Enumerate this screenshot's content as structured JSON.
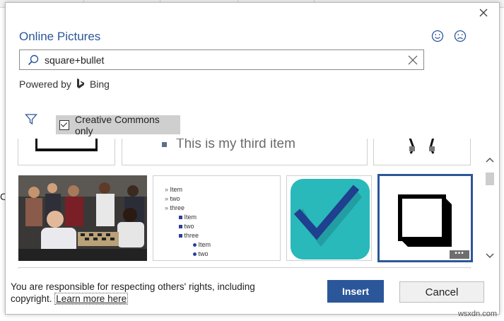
{
  "dialog": {
    "title": "Online Pictures",
    "close_icon": "close-icon",
    "feedback": {
      "smile_icon": "smile-icon",
      "frown_icon": "frown-icon"
    }
  },
  "search": {
    "value": "square+bullet",
    "icon": "search-icon",
    "clear_icon": "clear-icon"
  },
  "powered_by": {
    "label": "Powered by",
    "brand": "Bing",
    "logo_icon": "bing-logo-icon"
  },
  "filter": {
    "icon": "filter-icon",
    "creative_commons": {
      "label": "Creative Commons only",
      "checked": true
    }
  },
  "results": {
    "top_row_caption": "This is my third item",
    "list_tile": {
      "level1": [
        "Item",
        "two",
        "three"
      ],
      "level2": [
        "Item",
        "two",
        "three"
      ],
      "level3": [
        "Item",
        "two"
      ]
    },
    "more_icon": "more-options-icon"
  },
  "footer": {
    "notice": "You are responsible for respecting others' rights, including copyright.",
    "learn_more": "Learn more here",
    "insert_label": "Insert",
    "cancel_label": "Cancel"
  },
  "colors": {
    "accent": "#2b579a",
    "checkmark_bg": "#29b9ba",
    "checkmark": "#1f3f8f",
    "selection_border": "#2b579a"
  },
  "watermark": "wsxdn.com"
}
